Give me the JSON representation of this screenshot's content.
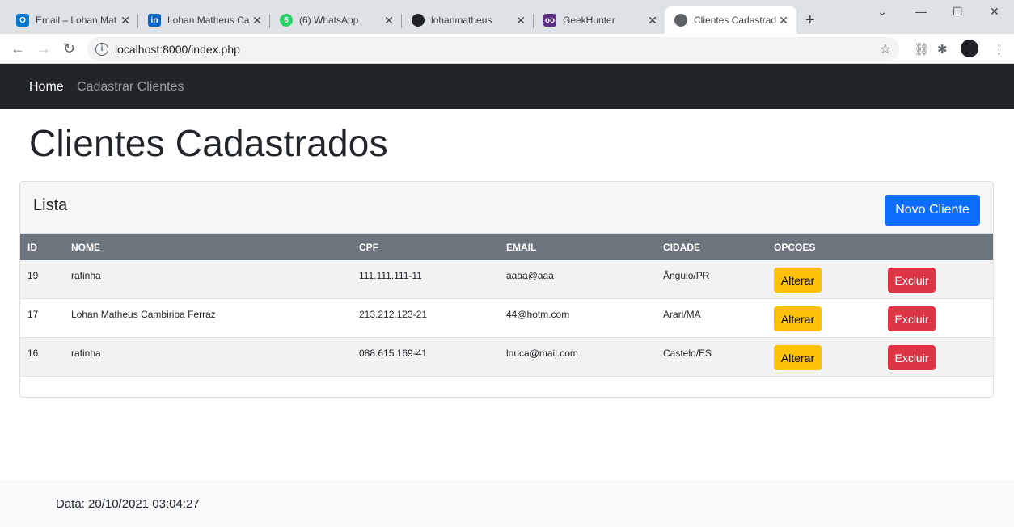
{
  "browser": {
    "tabs": [
      {
        "title": "Email – Lohan Mat",
        "favicon": "outlook-icon",
        "color": "#0078d4",
        "glyph": "O"
      },
      {
        "title": "Lohan Matheus Ca",
        "favicon": "linkedin-icon",
        "color": "#0a66c2",
        "glyph": "in"
      },
      {
        "title": "(6) WhatsApp",
        "favicon": "whatsapp-icon",
        "color": "#25d366",
        "glyph": "6"
      },
      {
        "title": "lohanmatheus",
        "favicon": "github-icon",
        "color": "#202124",
        "glyph": "●"
      },
      {
        "title": "GeekHunter",
        "favicon": "geekhunter-icon",
        "color": "#5a2d82",
        "glyph": "oo"
      },
      {
        "title": "Clientes Cadastrad",
        "favicon": "globe-icon",
        "color": "#5f6368",
        "glyph": "●"
      }
    ],
    "url": "localhost:8000/index.php"
  },
  "navbar": {
    "home": "Home",
    "cadastrar": "Cadastrar Clientes"
  },
  "page": {
    "title": "Clientes Cadastrados"
  },
  "card": {
    "header": "Lista",
    "new_button": "Novo Cliente"
  },
  "table": {
    "columns": [
      "ID",
      "NOME",
      "CPF",
      "EMAIL",
      "CIDADE",
      "OPCOES"
    ],
    "rows": [
      {
        "id": "19",
        "nome": "rafinha",
        "cpf": "111.111.111-11",
        "email": "aaaa@aaa",
        "cidade": "Ângulo/PR"
      },
      {
        "id": "17",
        "nome": "Lohan Matheus Cambiriba Ferraz",
        "cpf": "213.212.123-21",
        "email": "44@hotm.com",
        "cidade": "Arari/MA"
      },
      {
        "id": "16",
        "nome": "rafinha",
        "cpf": "088.615.169-41",
        "email": "louca@mail.com",
        "cidade": "Castelo/ES"
      }
    ],
    "alter_label": "Alterar",
    "delete_label": "Excluir"
  },
  "footer": {
    "text": "Data: 20/10/2021 03:04:27"
  },
  "colors": {
    "primary": "#0d6efd",
    "warning": "#ffc107",
    "danger": "#dc3545",
    "dark": "#212529",
    "table_head": "#6c757d"
  }
}
